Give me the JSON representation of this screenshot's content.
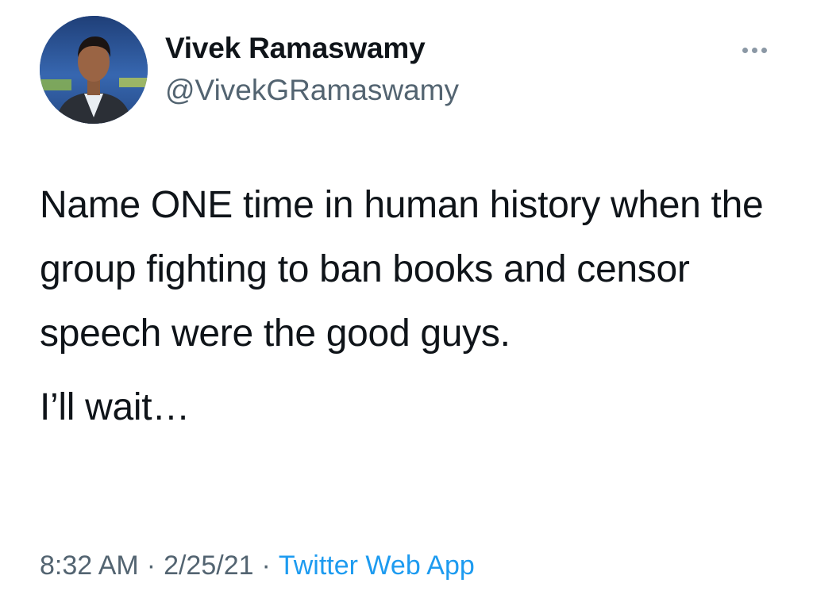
{
  "tweet": {
    "author": {
      "display_name": "Vivek Ramaswamy",
      "handle": "@VivekGRamaswamy",
      "avatar_icon": "profile-photo"
    },
    "more_icon": "more-horizontal-icon",
    "text_paragraph_1": "Name ONE time in human history when the group fighting to ban books and censor speech were the good guys.",
    "text_paragraph_2": "I’ll wait…",
    "time": "8:32 AM",
    "date": "2/25/21",
    "separator": "·",
    "source": "Twitter Web App"
  },
  "colors": {
    "text": "#0f1419",
    "secondary": "#536471",
    "link": "#1d9bf0"
  }
}
